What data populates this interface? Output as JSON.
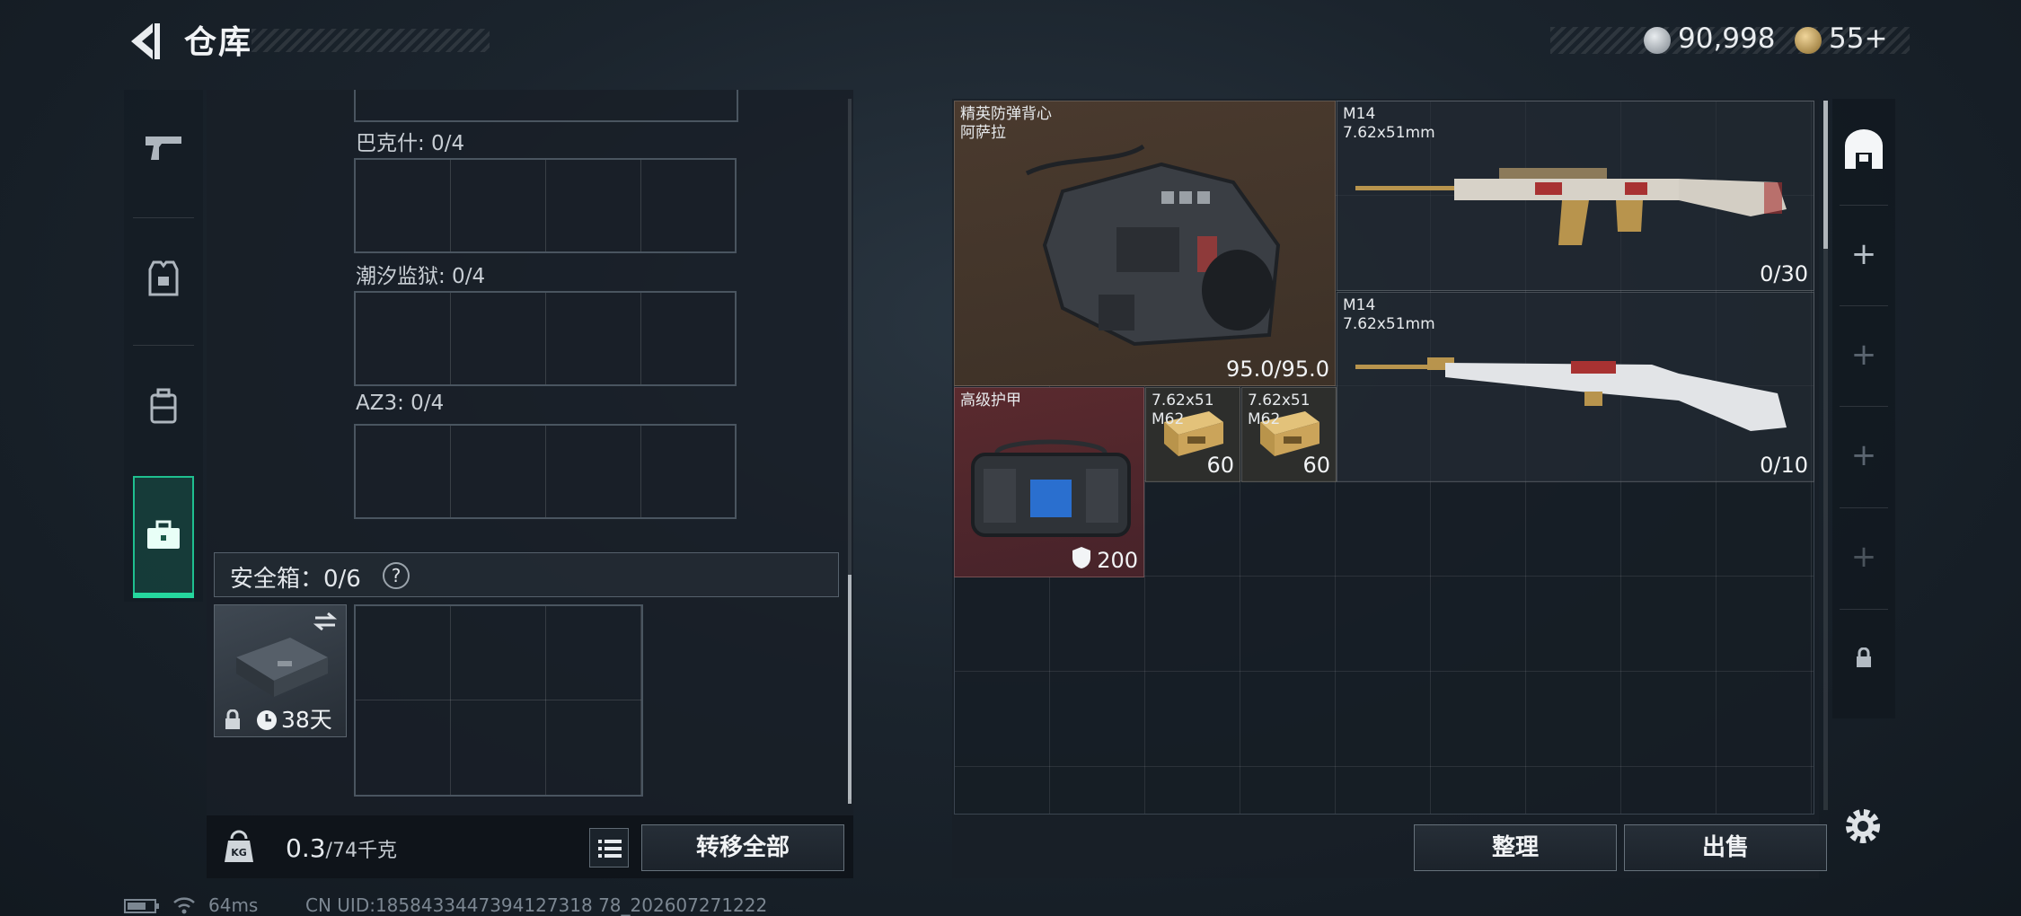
{
  "header": {
    "title": "仓库",
    "silver": "90,998",
    "gold": "55+"
  },
  "sidebar": {
    "items": [
      {
        "name": "pistol-icon",
        "glyph": "⌐"
      },
      {
        "name": "armor-vest-icon",
        "glyph": "⛨"
      },
      {
        "name": "backpack-icon",
        "glyph": "▤"
      },
      {
        "name": "toolbox-icon",
        "glyph": "⊞"
      }
    ]
  },
  "loadout": {
    "sections": [
      {
        "label": "巴克什: 0/4"
      },
      {
        "label": "潮汐监狱: 0/4"
      },
      {
        "label": "AZ3: 0/4"
      }
    ],
    "safe_box": {
      "label": "安全箱：0/6",
      "help": "?",
      "duration": "38天"
    },
    "weight": {
      "current": "0.3",
      "max": "/74千克"
    },
    "transfer_all": "转移全部"
  },
  "stash": {
    "items": [
      {
        "name": "精英防弹背心\n阿萨拉",
        "value": "95.0/95.0"
      },
      {
        "name": "M14\n7.62x51mm",
        "value": "0/30"
      },
      {
        "name": "M14\n7.62x51mm",
        "value": "0/10"
      },
      {
        "name": "高级护甲",
        "value": "200"
      },
      {
        "name": "7.62x51\nM62",
        "value": "60"
      },
      {
        "name": "7.62x51\nM62",
        "value": "60"
      }
    ],
    "sort": "整理",
    "sell": "出售"
  },
  "rail": {
    "add": "+",
    "lock": "🔒"
  },
  "statusbar": {
    "ping": "64ms",
    "uid": "CN UID:1858433447394127318 78_202607271222"
  },
  "colors": {
    "accent": "#25d79e",
    "vest_bg": "#4a3a2e",
    "armor_bg": "#5a2a2e"
  }
}
